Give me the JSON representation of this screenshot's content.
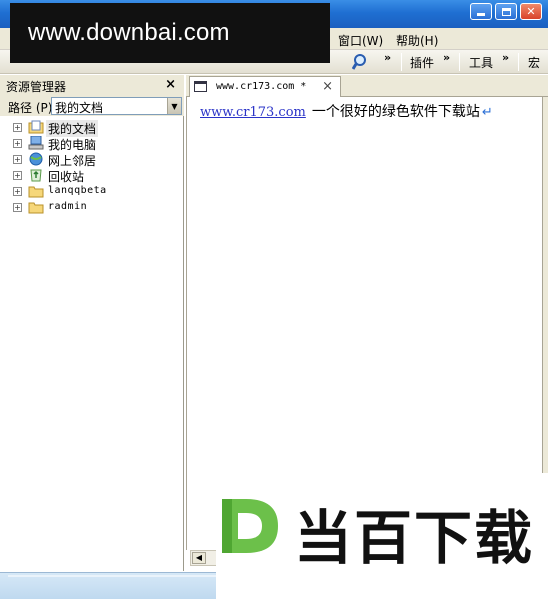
{
  "watermark_text": "www.downbai.com",
  "menubar": {
    "items": [
      {
        "label": "窗口(W)"
      },
      {
        "label": "帮助(H)"
      }
    ]
  },
  "toolbar": {
    "plugins_label": "插件",
    "tools_label": "工具",
    "macro_label": "宏",
    "overflow_glyph": "»"
  },
  "explorer": {
    "title": "资源管理器",
    "close_glyph": "×",
    "path_label": "路径 (P)",
    "path_value": "我的文档",
    "tree": [
      {
        "label": "我的文档",
        "icon": "documents-icon"
      },
      {
        "label": "我的电脑",
        "icon": "computer-icon"
      },
      {
        "label": "网上邻居",
        "icon": "network-icon"
      },
      {
        "label": "回收站",
        "icon": "recycle-bin-icon"
      },
      {
        "label": "lanqqbeta",
        "icon": "folder-icon"
      },
      {
        "label": "radmin",
        "icon": "folder-icon"
      }
    ]
  },
  "editor": {
    "tab_label": "www.cr173.com *",
    "tab_close": "×",
    "link_text": "www.cr173.com",
    "body_text": "一个很好的绿色软件下载站",
    "return_mark": "↵"
  },
  "brand": {
    "text": "当百下载",
    "colors": {
      "logo_green": "#6cc04a",
      "text": "#111111"
    }
  },
  "colors": {
    "titlebar": "#1f6fd2",
    "chrome": "#ece9d8",
    "statusbar": "#c8e0f4",
    "link": "#2b34c8"
  }
}
